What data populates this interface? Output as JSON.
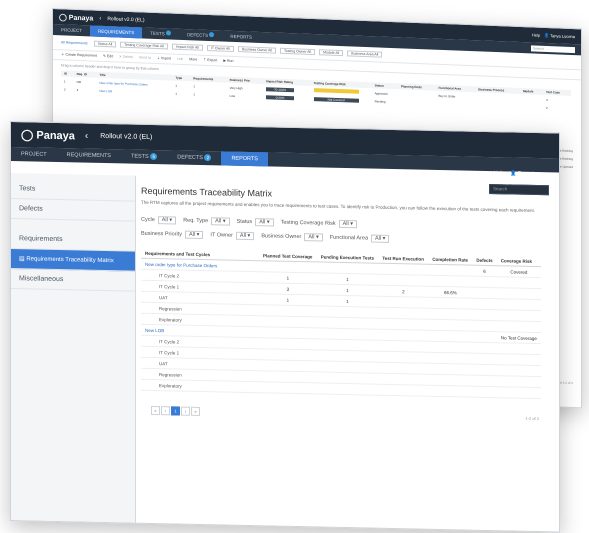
{
  "back": {
    "logo": "Panaya",
    "project_name": "Rollout v2.0 (EL)",
    "tabs": [
      {
        "label": "PROJECT"
      },
      {
        "label": "REQUIREMENTS"
      },
      {
        "label": "TESTS"
      },
      {
        "label": "DEFECTS"
      },
      {
        "label": "REPORTS"
      }
    ],
    "user_help": "Help",
    "user_name": "Tanya Lucena",
    "search_placeholder": "Search",
    "filter_row": {
      "all_requirements": "All Requirements",
      "status": "Status  All",
      "testing_coverage": "Testing Coverage Risk  All",
      "impact_risk": "Impact Risk  All",
      "it_owner": "IT Owner  All",
      "business_owner": "Business Owner  All",
      "testing_owner": "Testing Owner  All",
      "module": "Module  All",
      "business_area": "Business Area  All"
    },
    "toolbar": {
      "create": "Create Requirement",
      "edit": "Edit",
      "delete": "Delete",
      "send": "Send to",
      "import": "Import",
      "link": "Link",
      "more": "More",
      "export": "Export",
      "run": "Run"
    },
    "drag_hint": "Drag a column header and drop it here to group by that column",
    "columns": [
      "ID",
      "Req. ID",
      "Title",
      "Type",
      "Requirements",
      "Business Prio",
      "Impact Risk Rating",
      "Testing Coverage Risk",
      "Status",
      "Planning Ends",
      "Functional Area",
      "Business Process",
      "Module",
      "Test Case"
    ],
    "rows": [
      {
        "id": "1",
        "req": "NR",
        "title": "New order type for Purchase Orders",
        "c1": "1",
        "c2": "1",
        "bp": "Very High",
        "bar1": "70-100%",
        "bar2": "",
        "status": "Approved",
        "fa": "Buy to Order",
        "tc": "4"
      },
      {
        "id": "2",
        "req": "4",
        "title": "New LOB",
        "c1": "1",
        "c2": "1",
        "bp": "Low",
        "bar1": "0-20%",
        "bar2": "Not Covered",
        "status": "Pending",
        "fa": "",
        "tc": "2"
      }
    ],
    "side_links": [
      "Hide Backlog",
      "Hide Backlog",
      "Hide Opened"
    ],
    "footer": "Items 1-2 of 2"
  },
  "front": {
    "logo": "Panaya",
    "project_name": "Rollout v2.0 (EL)",
    "tabs": [
      {
        "label": "PROJECT",
        "badge": ""
      },
      {
        "label": "REQUIREMENTS",
        "badge": ""
      },
      {
        "label": "TESTS",
        "badge": "5"
      },
      {
        "label": "DEFECTS",
        "badge": "2"
      },
      {
        "label": "REPORTS",
        "badge": ""
      }
    ],
    "user_help": "Help",
    "user_name": "Tanya Lucena",
    "search_placeholder": "Search",
    "sidebar": [
      {
        "label": "Tests",
        "active": false
      },
      {
        "label": "Defects",
        "active": false
      },
      {
        "label": "Requirements",
        "active": false
      },
      {
        "label": "Requirements Traceability Matrix",
        "active": true
      },
      {
        "label": "Miscellaneous",
        "active": false
      }
    ],
    "page_title": "Requirements Traceability Matrix",
    "description": "The RTM captures all the project requirements and enables you to trace requirements to test cases. To identify risk to Production, you can follow the execution of the tests covering each requirement.",
    "filters_row1": [
      {
        "label": "Cycle",
        "value": "All"
      },
      {
        "label": "Req. Type",
        "value": "All"
      },
      {
        "label": "Status",
        "value": "All"
      },
      {
        "label": "Testing Coverage Risk",
        "value": "All"
      }
    ],
    "filters_row2": [
      {
        "label": "Business Priority",
        "value": "All"
      },
      {
        "label": "IT Owner",
        "value": "All"
      },
      {
        "label": "Business Owner",
        "value": "All"
      },
      {
        "label": "Functional Area",
        "value": "All"
      }
    ],
    "table": {
      "headers": [
        "Requirements and Test Cycles",
        "Planned Test Coverage",
        "Pending Execution Tests",
        "Test Run Execution",
        "Completion Rate",
        "Defects",
        "Coverage Risk"
      ],
      "rows": [
        {
          "name": "New order type for Purchase Orders",
          "type": "req",
          "planned": "",
          "pending": "",
          "run": "",
          "rate": "",
          "defects": "6",
          "risk": "Covered"
        },
        {
          "name": "IT Cycle 2",
          "type": "sub",
          "planned": "1",
          "pending": "1",
          "run": "",
          "rate": "",
          "defects": "",
          "risk": ""
        },
        {
          "name": "IT Cycle 1",
          "type": "sub",
          "planned": "3",
          "pending": "1",
          "run": "2",
          "rate": "66.6%",
          "defects": "",
          "risk": ""
        },
        {
          "name": "UAT",
          "type": "sub",
          "planned": "1",
          "pending": "1",
          "run": "",
          "rate": "",
          "defects": "",
          "risk": ""
        },
        {
          "name": "Regression",
          "type": "sub",
          "planned": "",
          "pending": "",
          "run": "",
          "rate": "",
          "defects": "",
          "risk": ""
        },
        {
          "name": "Exploratory",
          "type": "sub",
          "planned": "",
          "pending": "",
          "run": "",
          "rate": "",
          "defects": "",
          "risk": ""
        },
        {
          "name": "New LOB",
          "type": "req",
          "planned": "",
          "pending": "",
          "run": "",
          "rate": "",
          "defects": "",
          "risk": "No Test Coverage"
        },
        {
          "name": "IT Cycle 2",
          "type": "sub",
          "planned": "",
          "pending": "",
          "run": "",
          "rate": "",
          "defects": "",
          "risk": ""
        },
        {
          "name": "IT Cycle 1",
          "type": "sub",
          "planned": "",
          "pending": "",
          "run": "",
          "rate": "",
          "defects": "",
          "risk": ""
        },
        {
          "name": "UAT",
          "type": "sub",
          "planned": "",
          "pending": "",
          "run": "",
          "rate": "",
          "defects": "",
          "risk": ""
        },
        {
          "name": "Regression",
          "type": "sub",
          "planned": "",
          "pending": "",
          "run": "",
          "rate": "",
          "defects": "",
          "risk": ""
        },
        {
          "name": "Exploratory",
          "type": "sub",
          "planned": "",
          "pending": "",
          "run": "",
          "rate": "",
          "defects": "",
          "risk": ""
        }
      ]
    },
    "pagination": {
      "first": "«",
      "prev": "‹",
      "page": "1",
      "next": "›",
      "last": "»",
      "summary": "1-2 of 2"
    }
  },
  "colors": {
    "topbar": "#1f2b38",
    "navbar": "#2a3746",
    "accent": "#3a7bd5",
    "bar_yellow": "#f0c93a",
    "bar_dark": "#3d4b59"
  }
}
